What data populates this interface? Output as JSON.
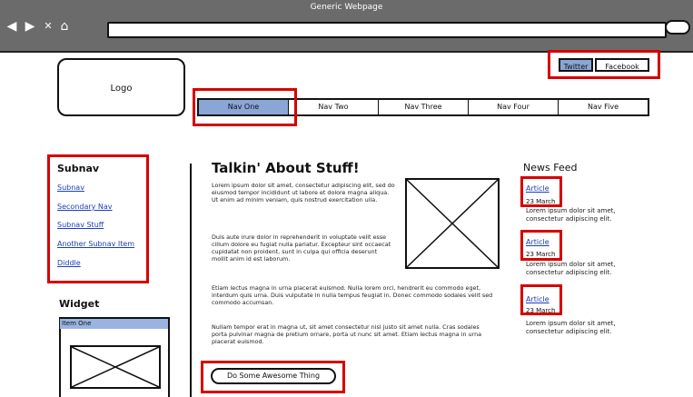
{
  "window": {
    "title": "Generic Webpage"
  },
  "browser": {
    "nav_icons": [
      "back-arrow-icon",
      "forward-arrow-icon",
      "close-x-icon",
      "home-icon"
    ],
    "url": "",
    "search_icon": "search-icon"
  },
  "header": {
    "logo_text": "Logo",
    "social": {
      "twitter": "Twitter",
      "facebook": "Facebook"
    }
  },
  "nav": {
    "items": [
      {
        "label": "Nav One",
        "active": true
      },
      {
        "label": "Nav Two"
      },
      {
        "label": "Nav Three"
      },
      {
        "label": "Nav Four"
      },
      {
        "label": "Nav Five"
      }
    ]
  },
  "sidebar": {
    "title": "Subnav",
    "links": [
      "Subnav",
      "Secondary Nav",
      "Subnav Stuff",
      "Another Subnav Item",
      "Diddle"
    ],
    "widget": {
      "title": "Widget",
      "item": "Item One"
    }
  },
  "main": {
    "heading": "Talkin' About Stuff!",
    "para1": "Lorem ipsum dolor sit amet, consectetur adipiscing elit, sed do eiusmod tempor incididunt ut labore et dolore magna aliqua. Ut enim ad minim veniam, quis nostrud exercitation ulla.",
    "para2": "Duis aute irure dolor in reprehenderit in voluptate velit esse cillum dolore eu fugiat nulla pariatur. Excepteur sint occaecat cupidatat non proident, sunt in culpa qui officia deserunt mollit anim id est laborum.",
    "para3": "Etiam lectus magna in urna placerat euismod. Nulla lorem orci, hendrerit eu commodo eget, interdum quis urna. Duis vulputate in nulla tempus feugiat in. Donec commodo sodales velit sed commodo accumsan.",
    "para4": "Nullam tempor erat in magna ut, sit amet consectetur nisl justo sit amet nulla. Cras sodales porta pulvinar magna de pretium ornare, porta ut nunc sit amet. Etiam lectus magna in urna placerat euismod.",
    "cta": "Do Some Awesome Thing"
  },
  "news": {
    "title": "News Feed",
    "items": [
      {
        "link": "Article",
        "date": "23 March",
        "text": "Lorem ipsum dolor sit amet, consectetur adipiscing elit."
      },
      {
        "link": "Article",
        "date": "23 March",
        "text": "Lorem ipsum dolor sit amet, consectetur adipiscing elit."
      },
      {
        "link": "Article",
        "date": "23 March",
        "text": "Lorem ipsum dolor sit amet, consectetur adipiscing elit."
      }
    ]
  },
  "colors": {
    "highlight": "#d60000",
    "link": "#1a3fb8",
    "active_nav": "#8aa6d6"
  }
}
